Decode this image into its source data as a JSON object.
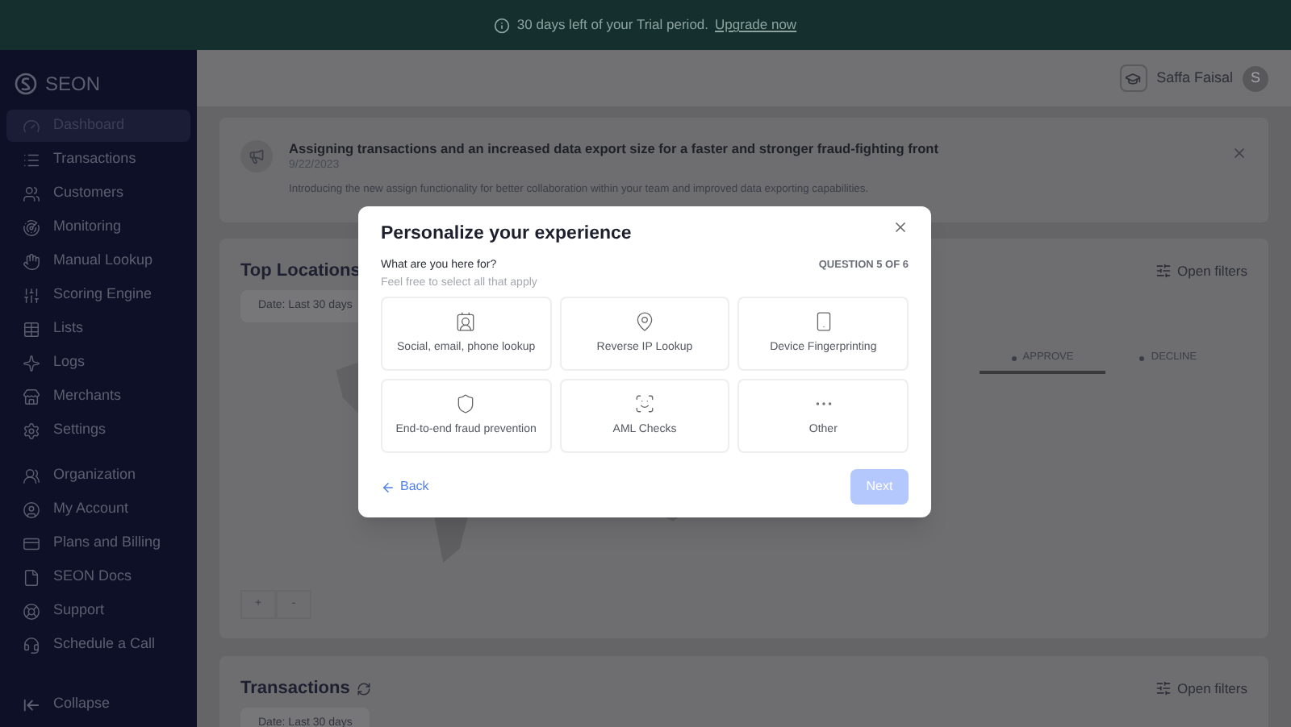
{
  "banner": {
    "text": "30 days left of your Trial period.",
    "link": "Upgrade now"
  },
  "sidebar": {
    "logo": "SEON",
    "items": [
      {
        "label": "Dashboard",
        "selected": true
      },
      {
        "label": "Transactions",
        "selected": false
      },
      {
        "label": "Customers",
        "selected": false
      },
      {
        "label": "Monitoring",
        "selected": false
      },
      {
        "label": "Manual Lookup",
        "selected": false
      },
      {
        "label": "Scoring Engine",
        "selected": false
      },
      {
        "label": "Lists",
        "selected": false
      },
      {
        "label": "Logs",
        "selected": false
      },
      {
        "label": "Merchants",
        "selected": false
      },
      {
        "label": "Settings",
        "selected": false
      }
    ],
    "footer_items": [
      {
        "label": "Organization",
        "selected": false
      },
      {
        "label": "My Account",
        "selected": false
      },
      {
        "label": "Plans and Billing",
        "selected": false
      },
      {
        "label": "SEON Docs",
        "selected": false
      },
      {
        "label": "Support",
        "selected": false
      },
      {
        "label": "Schedule a Call",
        "selected": false
      }
    ],
    "collapse": "Collapse"
  },
  "header": {
    "user_name": "Saffa Faisal",
    "avatar_initial": "S"
  },
  "announcement": {
    "title": "Assigning transactions and an increased data export size for a faster and stronger fraud-fighting front",
    "date": "9/22/2023",
    "body": "Introducing the new assign functionality for better collaboration within your team and improved data exporting capabilities."
  },
  "top_locations": {
    "title": "Top Locations",
    "date_filter": "Date: Last 30 days",
    "filters_button": "Open filters",
    "tabs": [
      {
        "label": "APPROVE",
        "selected": true
      },
      {
        "label": "DECLINE",
        "selected": false
      }
    ],
    "zoom_in": "+",
    "zoom_out": "-"
  },
  "transactions": {
    "title": "Transactions",
    "date_filter": "Date: Last 30 days",
    "filters_button": "Open filters"
  },
  "modal": {
    "title": "Personalize your experience",
    "question": "What are you here for?",
    "hint": "Feel free to select all that apply",
    "progress": "QUESTION 5 OF 6",
    "options": [
      {
        "label": "Social, email, phone lookup",
        "selected": false
      },
      {
        "label": "Reverse IP Lookup",
        "selected": false
      },
      {
        "label": "Device Fingerprinting",
        "selected": false
      },
      {
        "label": "End-to-end fraud prevention",
        "selected": false
      },
      {
        "label": "AML Checks",
        "selected": false
      },
      {
        "label": "Other",
        "selected": false
      }
    ],
    "back": "Back",
    "next": "Next",
    "next_disabled": true
  }
}
